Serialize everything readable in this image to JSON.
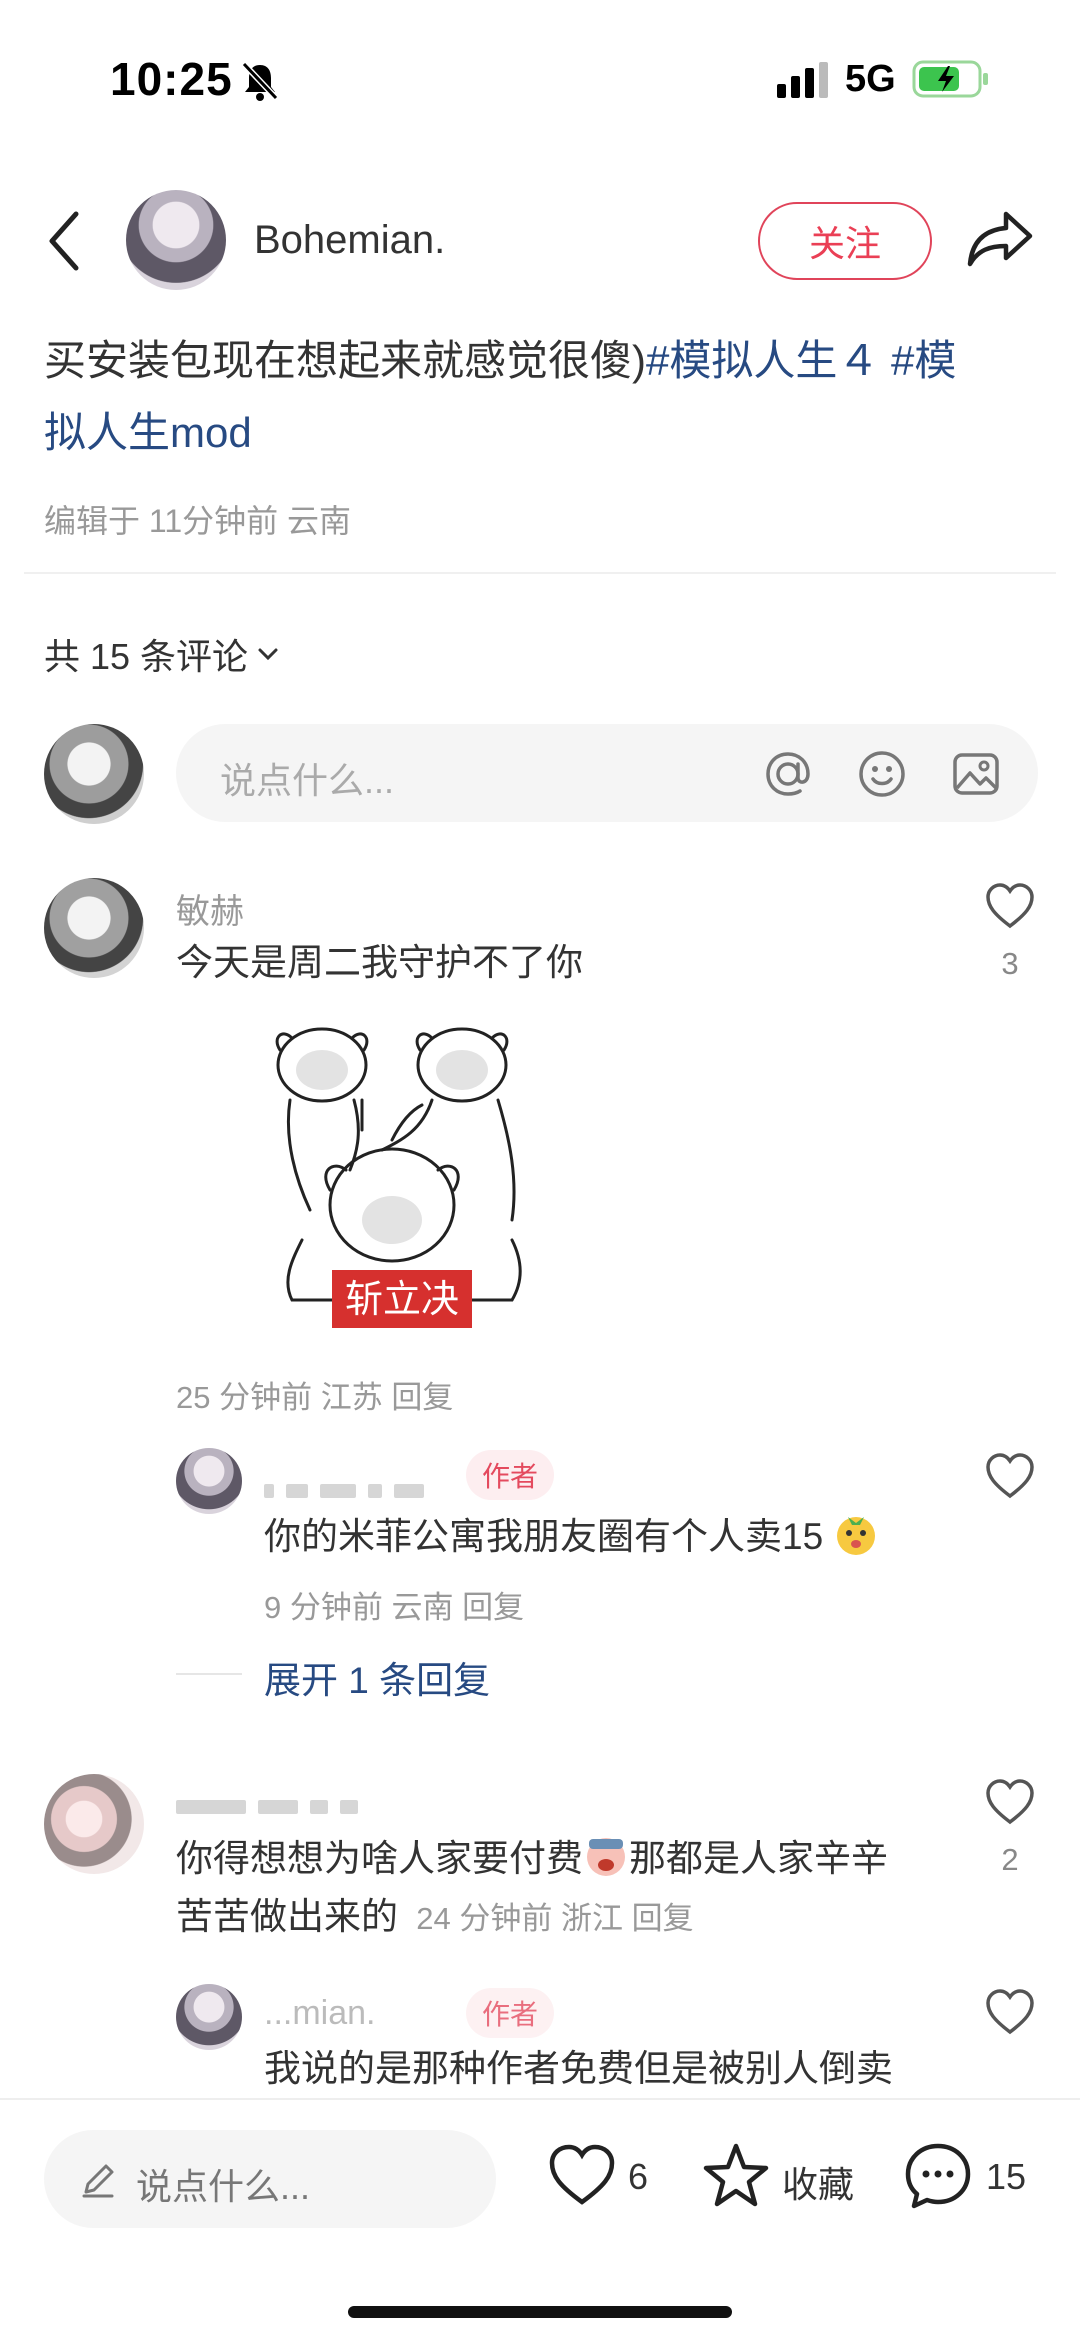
{
  "status_bar": {
    "time": "10:25",
    "network": "5G"
  },
  "header": {
    "author_name": "Bohemian.",
    "follow_label": "关注"
  },
  "post": {
    "text_plain": "买安装包现在想起来就感觉很傻)",
    "tag1": "#模拟人生４",
    "tag2_line1": "#模",
    "tag2_line2": "拟人生mod",
    "meta": "编辑于 11分钟前 云南"
  },
  "comments_header": {
    "label": "共 15 条评论"
  },
  "comment_input": {
    "placeholder": "说点什么..."
  },
  "comments": [
    {
      "name": "敏赫",
      "text": "今天是周二我守护不了你",
      "sticker_caption": "斩立决",
      "meta": "25 分钟前  江苏  回复",
      "likes": "3"
    },
    {
      "badge": "作者",
      "text": "你的米菲公寓我朋友圈有个人卖15",
      "meta": "9 分钟前  云南  回复"
    },
    {
      "expand_label": "展开 1 条回复"
    },
    {
      "text_line1": "你得想想为啥人家要付费",
      "text_line1b": "那都是人家辛辛",
      "text_line2": "苦苦做出来的",
      "meta": "24 分钟前  浙江  回复",
      "likes": "2"
    },
    {
      "name_partial": "...mian.",
      "badge": "作者",
      "text": "我说的是那种作者免费但是被别人倒卖"
    }
  ],
  "bottom_bar": {
    "placeholder": "说点什么...",
    "likes": "6",
    "collect_label": "收藏",
    "comments": "15"
  },
  "colors": {
    "accent_red": "#ea3f55",
    "tag_blue": "#274a82",
    "gray_text": "#999999"
  }
}
